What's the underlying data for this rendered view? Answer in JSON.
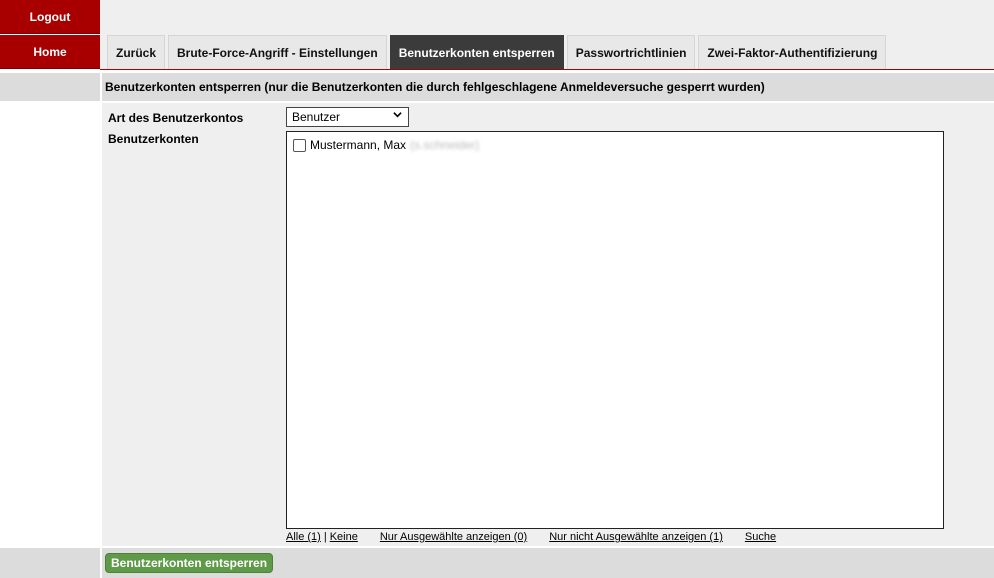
{
  "sidebar": {
    "logout_label": "Logout",
    "home_label": "Home"
  },
  "tabs": [
    {
      "label": "Zurück",
      "active": false
    },
    {
      "label": "Brute-Force-Angriff - Einstellungen",
      "active": false
    },
    {
      "label": "Benutzerkonten entsperren",
      "active": true
    },
    {
      "label": "Passwortrichtlinien",
      "active": false
    },
    {
      "label": "Zwei-Faktor-Authentifizierung",
      "active": false
    }
  ],
  "section": {
    "title": "Benutzerkonten entsperren (nur die Benutzerkonten die durch fehlgeschlagene Anmeldeversuche gesperrt wurden)"
  },
  "form": {
    "account_type_label": "Art des Benutzerkontos",
    "account_type_value": "Benutzer",
    "accounts_label": "Benutzerkonten",
    "accounts": [
      {
        "name": "Mustermann, Max",
        "detail": "(s.schneider)",
        "checked": false
      }
    ]
  },
  "filter_links": {
    "all": "Alle (1)",
    "separator": "|",
    "none": "Keine",
    "only_selected": "Nur Ausgewählte anzeigen (0)",
    "only_unselected": "Nur nicht Ausgewählte anzeigen (1)",
    "search": "Suche"
  },
  "footer": {
    "unlock_button": "Benutzerkonten entsperren"
  },
  "colors": {
    "brand_red": "#a80000",
    "active_tab": "#3b3b3b",
    "button_green": "#5e9a48"
  }
}
